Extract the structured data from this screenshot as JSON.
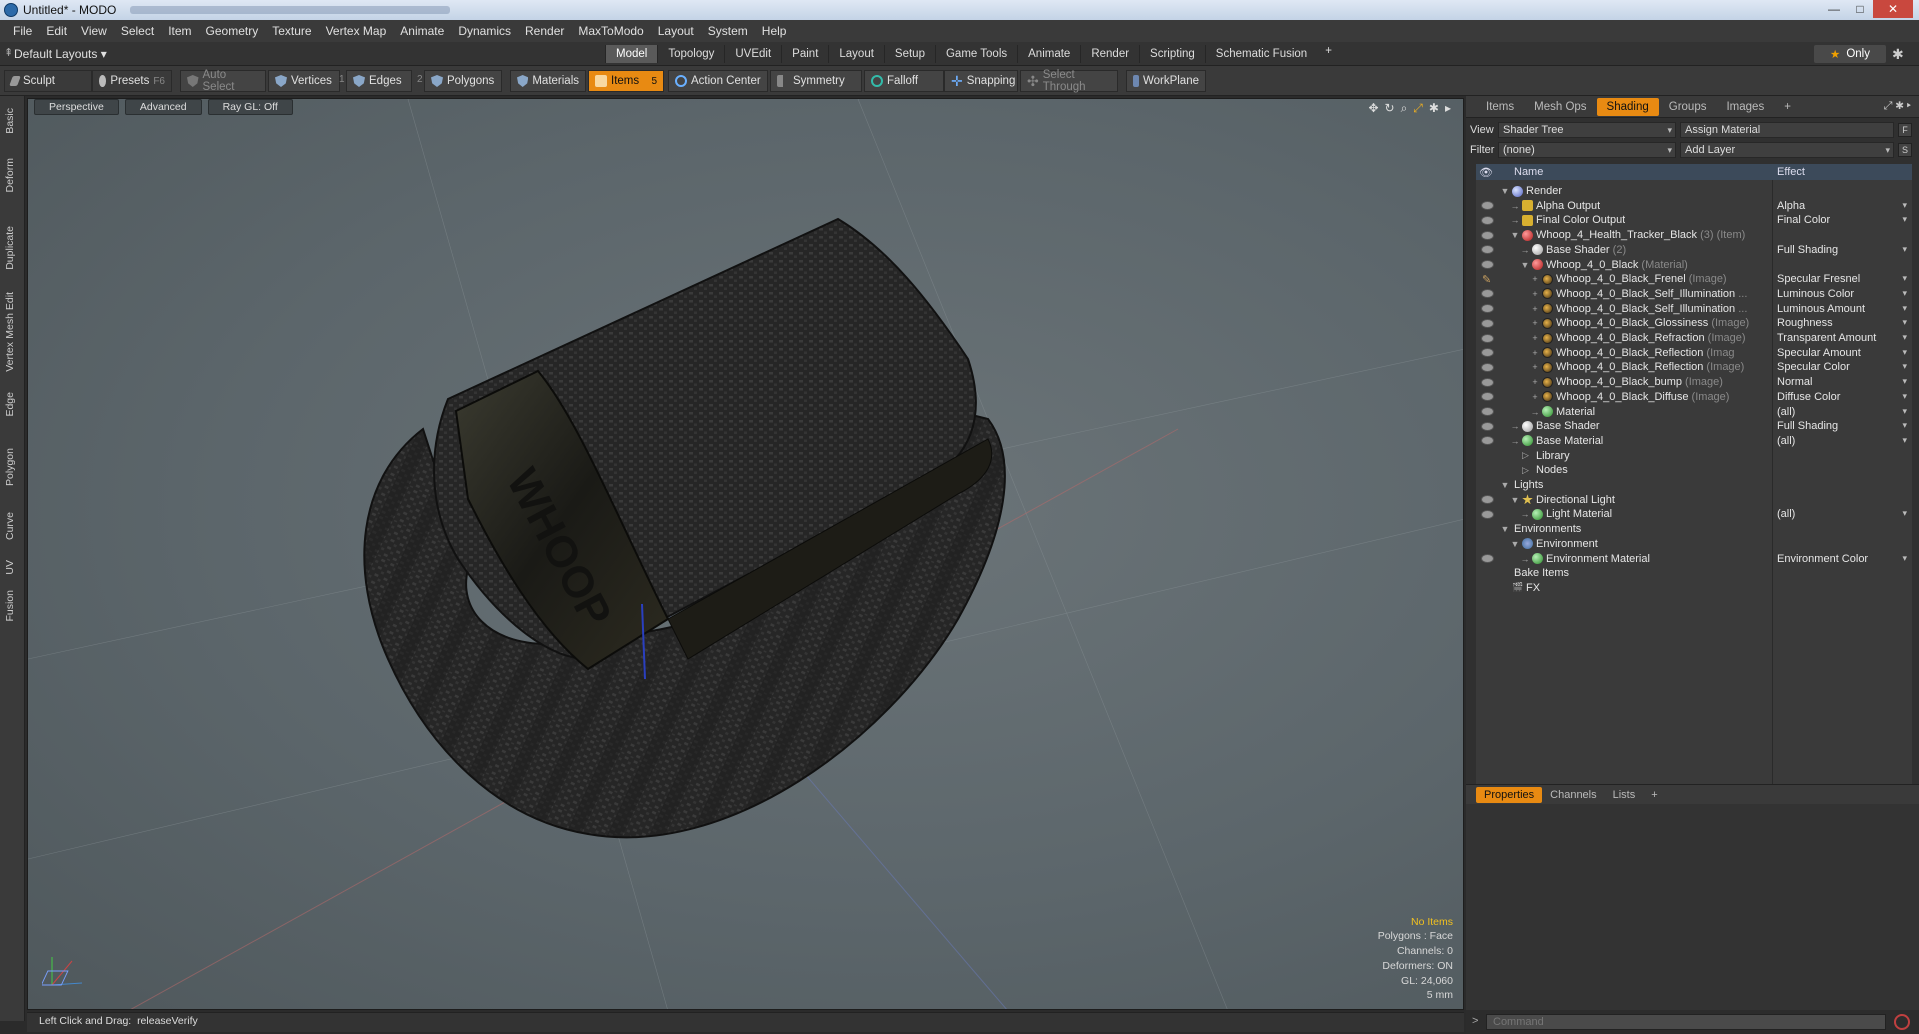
{
  "window": {
    "title": "Untitled* - MODO",
    "controls": {
      "minimize": "—",
      "maximize": "□",
      "close": "✕"
    }
  },
  "menu": [
    "File",
    "Edit",
    "View",
    "Select",
    "Item",
    "Geometry",
    "Texture",
    "Vertex Map",
    "Animate",
    "Dynamics",
    "Render",
    "MaxToModo",
    "Layout",
    "System",
    "Help"
  ],
  "layout": {
    "selector": "Default Layouts",
    "tabs": [
      "Model",
      "Topology",
      "UVEdit",
      "Paint",
      "Layout",
      "Setup",
      "Game Tools",
      "Animate",
      "Render",
      "Scripting",
      "Schematic Fusion"
    ],
    "active_tab": "Model",
    "add": "+",
    "only": "Only"
  },
  "toolbar": {
    "sculpt": "Sculpt",
    "presets": "Presets",
    "presets_key": "F6",
    "auto_select": "Auto Select",
    "vertices": "Vertices",
    "vertices_n": "1",
    "edges": "Edges",
    "edges_n": "2",
    "polygons": "Polygons",
    "materials": "Materials",
    "items": "Items",
    "items_n": "5",
    "action_center": "Action Center",
    "symmetry": "Symmetry",
    "falloff": "Falloff",
    "snapping": "Snapping",
    "select_through": "Select Through",
    "workplane": "WorkPlane"
  },
  "leftstrip": [
    "Basic",
    "Deform",
    "Duplicate",
    "Mesh Edit",
    "Vertex",
    "Edge",
    "Polygon",
    "Curve",
    "UV",
    "Fusion"
  ],
  "viewport": {
    "view": "Perspective",
    "style": "Advanced",
    "raygl": "Ray GL: Off",
    "model_text": "WHOOP",
    "hud": {
      "no_items": "No Items",
      "polygons": "Polygons : Face",
      "channels": "Channels: 0",
      "deformers": "Deformers: ON",
      "gl": "GL: 24,060",
      "scale": "5 mm"
    }
  },
  "status": {
    "hint": "Left Click and Drag:",
    "value": "releaseVerify"
  },
  "panel": {
    "tabs": [
      "Items",
      "Mesh Ops",
      "Shading",
      "Groups",
      "Images"
    ],
    "active_tab": "Shading",
    "add": "+",
    "view_label": "View",
    "view_value": "Shader Tree",
    "assign": "Assign Material",
    "assign_key": "F",
    "filter_label": "Filter",
    "filter_value": "(none)",
    "add_layer": "Add Layer",
    "add_layer_key": "S",
    "col_name": "Name",
    "col_effect": "Effect",
    "tree": [
      {
        "name": "Render",
        "sub": "",
        "effect": "",
        "icon": "sphere",
        "level": 0,
        "eye": false,
        "exp": "▼",
        "dd": false
      },
      {
        "name": "Alpha Output",
        "sub": "",
        "effect": "Alpha",
        "icon": "out",
        "level": 1,
        "eye": true,
        "exp": "→",
        "dd": true
      },
      {
        "name": "Final Color Output",
        "sub": "",
        "effect": "Final Color",
        "icon": "out",
        "level": 1,
        "eye": true,
        "exp": "→",
        "dd": true
      },
      {
        "name": "Whoop_4_Health_Tracker_Black",
        "sub": " (3) (Item)",
        "effect": "",
        "icon": "mat",
        "level": 1,
        "eye": true,
        "exp": "▼",
        "dd": false
      },
      {
        "name": "Base Shader",
        "sub": " (2)",
        "effect": "Full Shading",
        "icon": "shader",
        "level": 2,
        "eye": true,
        "exp": "→",
        "dd": true
      },
      {
        "name": "Whoop_4_0_Black",
        "sub": " (Material)",
        "effect": "",
        "icon": "mat",
        "level": 2,
        "eye": true,
        "exp": "▼",
        "dd": false
      },
      {
        "name": "Whoop_4_0_Black_Frenel",
        "sub": " (Image)",
        "effect": "Specular Fresnel",
        "icon": "img",
        "level": 3,
        "eye": "pen",
        "exp": "+",
        "dd": true
      },
      {
        "name": "Whoop_4_0_Black_Self_Illumination",
        "sub": " ...",
        "effect": "Luminous Color",
        "icon": "img",
        "level": 3,
        "eye": true,
        "exp": "+",
        "dd": true
      },
      {
        "name": "Whoop_4_0_Black_Self_Illumination",
        "sub": " ...",
        "effect": "Luminous Amount",
        "icon": "img",
        "level": 3,
        "eye": true,
        "exp": "+",
        "dd": true
      },
      {
        "name": "Whoop_4_0_Black_Glossiness",
        "sub": " (Image)",
        "effect": "Roughness",
        "icon": "img",
        "level": 3,
        "eye": true,
        "exp": "+",
        "dd": true
      },
      {
        "name": "Whoop_4_0_Black_Refraction",
        "sub": " (Image)",
        "effect": "Transparent Amount",
        "icon": "img",
        "level": 3,
        "eye": true,
        "exp": "+",
        "dd": true
      },
      {
        "name": "Whoop_4_0_Black_Reflection",
        "sub": " (Imag",
        "effect": "Specular Amount",
        "icon": "img",
        "level": 3,
        "eye": true,
        "exp": "+",
        "dd": true
      },
      {
        "name": "Whoop_4_0_Black_Reflection",
        "sub": " (Image)",
        "effect": "Specular Color",
        "icon": "img",
        "level": 3,
        "eye": true,
        "exp": "+",
        "dd": true
      },
      {
        "name": "Whoop_4_0_Black_bump",
        "sub": " (Image)",
        "effect": "Normal",
        "icon": "img",
        "level": 3,
        "eye": true,
        "exp": "+",
        "dd": true
      },
      {
        "name": "Whoop_4_0_Black_Diffuse",
        "sub": " (Image)",
        "effect": "Diffuse Color",
        "icon": "img",
        "level": 3,
        "eye": true,
        "exp": "+",
        "dd": true
      },
      {
        "name": "Material",
        "sub": "",
        "effect": "(all)",
        "icon": "green",
        "level": 3,
        "eye": true,
        "exp": "→",
        "dd": true
      },
      {
        "name": "Base Shader",
        "sub": "",
        "effect": "Full Shading",
        "icon": "shader",
        "level": 1,
        "eye": true,
        "exp": "→",
        "dd": true
      },
      {
        "name": "Base Material",
        "sub": "",
        "effect": "(all)",
        "icon": "green",
        "level": 1,
        "eye": true,
        "exp": "→",
        "dd": true
      },
      {
        "name": "Library",
        "sub": "",
        "effect": "",
        "icon": "folder",
        "level": 1,
        "eye": false,
        "exp": "",
        "dd": false
      },
      {
        "name": "Nodes",
        "sub": "",
        "effect": "",
        "icon": "folder",
        "level": 1,
        "eye": false,
        "exp": "",
        "dd": false
      },
      {
        "name": "Lights",
        "sub": "",
        "effect": "",
        "icon": "none",
        "level": 0,
        "eye": false,
        "exp": "▼",
        "dd": false
      },
      {
        "name": "Directional Light",
        "sub": "",
        "effect": "",
        "icon": "light",
        "level": 1,
        "eye": true,
        "exp": "▼",
        "dd": false
      },
      {
        "name": "Light Material",
        "sub": "",
        "effect": "(all)",
        "icon": "green",
        "level": 2,
        "eye": true,
        "exp": "→",
        "dd": true
      },
      {
        "name": "Environments",
        "sub": "",
        "effect": "",
        "icon": "none",
        "level": 0,
        "eye": false,
        "exp": "▼",
        "dd": false
      },
      {
        "name": "Environment",
        "sub": "",
        "effect": "",
        "icon": "env",
        "level": 1,
        "eye": false,
        "exp": "▼",
        "dd": false
      },
      {
        "name": "Environment Material",
        "sub": "",
        "effect": "Environment Color",
        "icon": "green",
        "level": 2,
        "eye": true,
        "exp": "→",
        "dd": true
      },
      {
        "name": "Bake Items",
        "sub": "",
        "effect": "",
        "icon": "none",
        "level": 0,
        "eye": false,
        "exp": "",
        "dd": false
      },
      {
        "name": "FX",
        "sub": "",
        "effect": "",
        "icon": "folder",
        "level": 0,
        "eye": false,
        "exp": "",
        "dd": false
      }
    ],
    "prop_tabs": [
      "Properties",
      "Channels",
      "Lists"
    ],
    "prop_active": "Properties",
    "prop_add": "+",
    "command_prompt": ">",
    "command_placeholder": "Command"
  },
  "colors": {
    "accent": "#e88a12",
    "viewport": "#5c666b",
    "panel": "#3a3a3a"
  }
}
